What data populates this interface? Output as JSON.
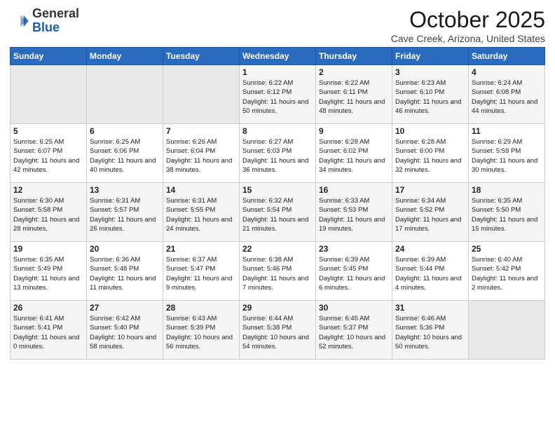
{
  "logo": {
    "general": "General",
    "blue": "Blue"
  },
  "title": "October 2025",
  "location": "Cave Creek, Arizona, United States",
  "days_header": [
    "Sunday",
    "Monday",
    "Tuesday",
    "Wednesday",
    "Thursday",
    "Friday",
    "Saturday"
  ],
  "weeks": [
    [
      {
        "day": "",
        "sunrise": "",
        "sunset": "",
        "daylight": ""
      },
      {
        "day": "",
        "sunrise": "",
        "sunset": "",
        "daylight": ""
      },
      {
        "day": "",
        "sunrise": "",
        "sunset": "",
        "daylight": ""
      },
      {
        "day": "1",
        "sunrise": "Sunrise: 6:22 AM",
        "sunset": "Sunset: 6:12 PM",
        "daylight": "Daylight: 11 hours and 50 minutes."
      },
      {
        "day": "2",
        "sunrise": "Sunrise: 6:22 AM",
        "sunset": "Sunset: 6:11 PM",
        "daylight": "Daylight: 11 hours and 48 minutes."
      },
      {
        "day": "3",
        "sunrise": "Sunrise: 6:23 AM",
        "sunset": "Sunset: 6:10 PM",
        "daylight": "Daylight: 11 hours and 46 minutes."
      },
      {
        "day": "4",
        "sunrise": "Sunrise: 6:24 AM",
        "sunset": "Sunset: 6:08 PM",
        "daylight": "Daylight: 11 hours and 44 minutes."
      }
    ],
    [
      {
        "day": "5",
        "sunrise": "Sunrise: 6:25 AM",
        "sunset": "Sunset: 6:07 PM",
        "daylight": "Daylight: 11 hours and 42 minutes."
      },
      {
        "day": "6",
        "sunrise": "Sunrise: 6:25 AM",
        "sunset": "Sunset: 6:06 PM",
        "daylight": "Daylight: 11 hours and 40 minutes."
      },
      {
        "day": "7",
        "sunrise": "Sunrise: 6:26 AM",
        "sunset": "Sunset: 6:04 PM",
        "daylight": "Daylight: 11 hours and 38 minutes."
      },
      {
        "day": "8",
        "sunrise": "Sunrise: 6:27 AM",
        "sunset": "Sunset: 6:03 PM",
        "daylight": "Daylight: 11 hours and 36 minutes."
      },
      {
        "day": "9",
        "sunrise": "Sunrise: 6:28 AM",
        "sunset": "Sunset: 6:02 PM",
        "daylight": "Daylight: 11 hours and 34 minutes."
      },
      {
        "day": "10",
        "sunrise": "Sunrise: 6:28 AM",
        "sunset": "Sunset: 6:00 PM",
        "daylight": "Daylight: 11 hours and 32 minutes."
      },
      {
        "day": "11",
        "sunrise": "Sunrise: 6:29 AM",
        "sunset": "Sunset: 5:59 PM",
        "daylight": "Daylight: 11 hours and 30 minutes."
      }
    ],
    [
      {
        "day": "12",
        "sunrise": "Sunrise: 6:30 AM",
        "sunset": "Sunset: 5:58 PM",
        "daylight": "Daylight: 11 hours and 28 minutes."
      },
      {
        "day": "13",
        "sunrise": "Sunrise: 6:31 AM",
        "sunset": "Sunset: 5:57 PM",
        "daylight": "Daylight: 11 hours and 26 minutes."
      },
      {
        "day": "14",
        "sunrise": "Sunrise: 6:31 AM",
        "sunset": "Sunset: 5:55 PM",
        "daylight": "Daylight: 11 hours and 24 minutes."
      },
      {
        "day": "15",
        "sunrise": "Sunrise: 6:32 AM",
        "sunset": "Sunset: 5:54 PM",
        "daylight": "Daylight: 11 hours and 21 minutes."
      },
      {
        "day": "16",
        "sunrise": "Sunrise: 6:33 AM",
        "sunset": "Sunset: 5:53 PM",
        "daylight": "Daylight: 11 hours and 19 minutes."
      },
      {
        "day": "17",
        "sunrise": "Sunrise: 6:34 AM",
        "sunset": "Sunset: 5:52 PM",
        "daylight": "Daylight: 11 hours and 17 minutes."
      },
      {
        "day": "18",
        "sunrise": "Sunrise: 6:35 AM",
        "sunset": "Sunset: 5:50 PM",
        "daylight": "Daylight: 11 hours and 15 minutes."
      }
    ],
    [
      {
        "day": "19",
        "sunrise": "Sunrise: 6:35 AM",
        "sunset": "Sunset: 5:49 PM",
        "daylight": "Daylight: 11 hours and 13 minutes."
      },
      {
        "day": "20",
        "sunrise": "Sunrise: 6:36 AM",
        "sunset": "Sunset: 5:48 PM",
        "daylight": "Daylight: 11 hours and 11 minutes."
      },
      {
        "day": "21",
        "sunrise": "Sunrise: 6:37 AM",
        "sunset": "Sunset: 5:47 PM",
        "daylight": "Daylight: 11 hours and 9 minutes."
      },
      {
        "day": "22",
        "sunrise": "Sunrise: 6:38 AM",
        "sunset": "Sunset: 5:46 PM",
        "daylight": "Daylight: 11 hours and 7 minutes."
      },
      {
        "day": "23",
        "sunrise": "Sunrise: 6:39 AM",
        "sunset": "Sunset: 5:45 PM",
        "daylight": "Daylight: 11 hours and 6 minutes."
      },
      {
        "day": "24",
        "sunrise": "Sunrise: 6:39 AM",
        "sunset": "Sunset: 5:44 PM",
        "daylight": "Daylight: 11 hours and 4 minutes."
      },
      {
        "day": "25",
        "sunrise": "Sunrise: 6:40 AM",
        "sunset": "Sunset: 5:42 PM",
        "daylight": "Daylight: 11 hours and 2 minutes."
      }
    ],
    [
      {
        "day": "26",
        "sunrise": "Sunrise: 6:41 AM",
        "sunset": "Sunset: 5:41 PM",
        "daylight": "Daylight: 11 hours and 0 minutes."
      },
      {
        "day": "27",
        "sunrise": "Sunrise: 6:42 AM",
        "sunset": "Sunset: 5:40 PM",
        "daylight": "Daylight: 10 hours and 58 minutes."
      },
      {
        "day": "28",
        "sunrise": "Sunrise: 6:43 AM",
        "sunset": "Sunset: 5:39 PM",
        "daylight": "Daylight: 10 hours and 56 minutes."
      },
      {
        "day": "29",
        "sunrise": "Sunrise: 6:44 AM",
        "sunset": "Sunset: 5:38 PM",
        "daylight": "Daylight: 10 hours and 54 minutes."
      },
      {
        "day": "30",
        "sunrise": "Sunrise: 6:45 AM",
        "sunset": "Sunset: 5:37 PM",
        "daylight": "Daylight: 10 hours and 52 minutes."
      },
      {
        "day": "31",
        "sunrise": "Sunrise: 6:46 AM",
        "sunset": "Sunset: 5:36 PM",
        "daylight": "Daylight: 10 hours and 50 minutes."
      },
      {
        "day": "",
        "sunrise": "",
        "sunset": "",
        "daylight": ""
      }
    ]
  ]
}
